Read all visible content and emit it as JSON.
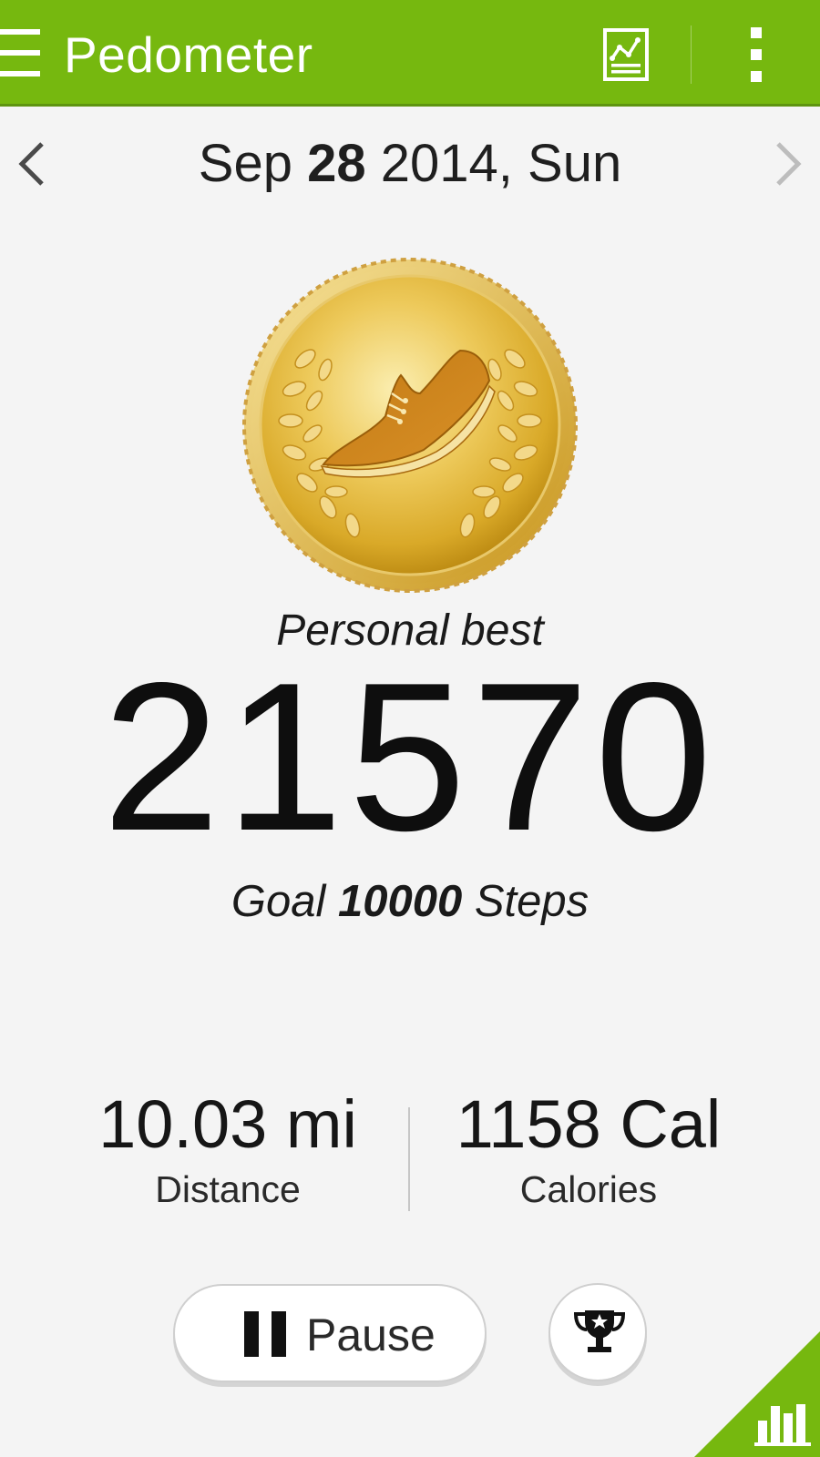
{
  "appbar": {
    "title": "Pedometer",
    "color": "#76b80f",
    "icons": [
      "menu-icon",
      "chart-icon",
      "overflow-menu-icon"
    ]
  },
  "date_nav": {
    "month": "Sep",
    "day": "28",
    "rest": "2014, Sun",
    "icons": [
      "chevron-left-icon",
      "chevron-right-icon"
    ]
  },
  "medal": {
    "icon": "shoe-medal-icon",
    "color": "#d9a928"
  },
  "steps": {
    "badge": "Personal best",
    "value": "21570",
    "goal_prefix": "Goal",
    "goal_value": "10000",
    "goal_suffix": "Steps"
  },
  "stats": {
    "distance": {
      "value": "10.03 mi",
      "label": "Distance"
    },
    "calories": {
      "value": "1158 Cal",
      "label": "Calories"
    }
  },
  "controls": {
    "pause_label": "Pause",
    "pause_icon": "pause-icon",
    "trophy_icon": "trophy-icon"
  },
  "corner_tab": {
    "icon": "bar-chart-icon",
    "color": "#76b80f"
  }
}
